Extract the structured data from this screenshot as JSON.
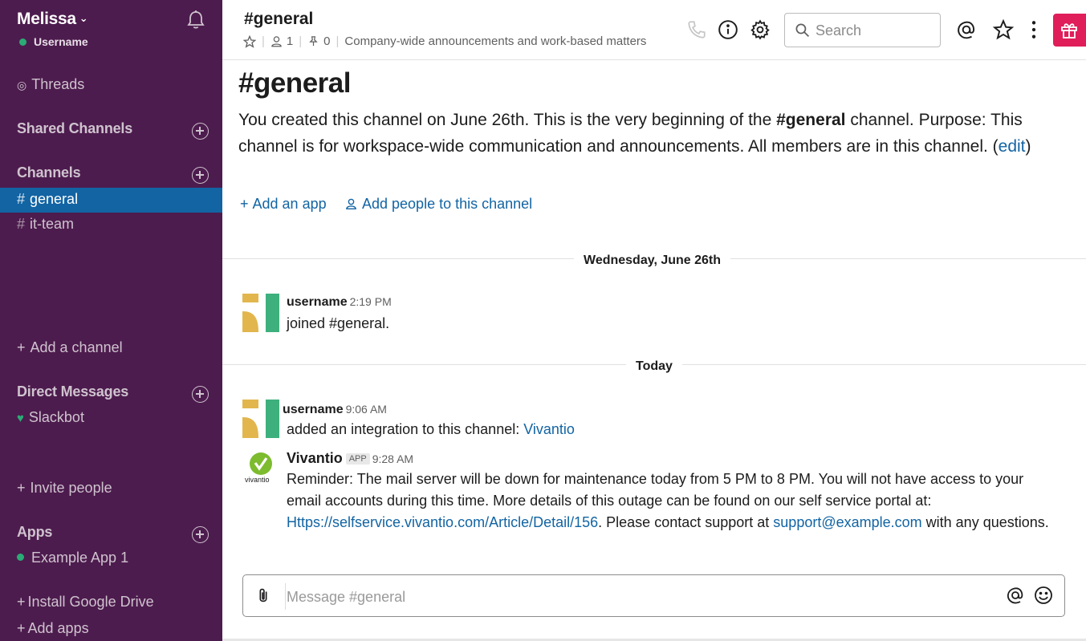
{
  "workspace": {
    "name": "Melissa",
    "user": "Username"
  },
  "sidebar": {
    "threads": "Threads",
    "shared_channels": "Shared Channels",
    "channels_heading": "Channels",
    "channels": [
      {
        "label": "general",
        "active": true
      },
      {
        "label": "it-team",
        "active": false
      }
    ],
    "add_channel": "Add a channel",
    "dm_heading": "Direct Messages",
    "dms": [
      {
        "label": "Slackbot"
      }
    ],
    "invite_people": "Invite people",
    "apps_heading": "Apps",
    "apps": [
      {
        "label": "Example App 1"
      }
    ],
    "install_google_drive": "Install Google Drive",
    "add_apps": "Add apps"
  },
  "header": {
    "title": "#general",
    "members_count": "1",
    "pins_count": "0",
    "topic": "Company-wide announcements and work-based matters",
    "search_placeholder": "Search"
  },
  "intro": {
    "title": "#general",
    "text_part1": "You created this channel on June 26th. This is the very beginning of the ",
    "channel_bold": "#general",
    "text_part2": " channel. Purpose: This channel is for workspace-wide communication and announcements. All members are in this channel. (",
    "edit_link": "edit",
    "text_part3": ")",
    "add_app": "Add an app",
    "add_people": "Add people to this channel"
  },
  "dividers": {
    "first": "Wednesday, June 26th",
    "second": "Today"
  },
  "messages": [
    {
      "author": "username",
      "time": "2:19 PM",
      "text": "joined #general."
    },
    {
      "author": "username",
      "time": "9:06 AM",
      "text": "added an integration to this channel: ",
      "link": "Vivantio"
    },
    {
      "author": "Vivantio",
      "badge": "APP",
      "time": "9:28 AM",
      "logo_text": "vivantio",
      "text_part1": "Reminder: The mail server will be down for maintenance today from 5 PM to 8 PM. You will not have access to your email accounts during this time. More details of this outage can be found on our self service portal at: ",
      "url": "Https://selfservice.vivantio.com/Article/Detail/156",
      "text_part2": ". Please contact support at ",
      "email": "support@example.com",
      "text_part3": " with any questions."
    }
  ],
  "composer": {
    "placeholder": "Message #general"
  },
  "colors": {
    "sidebar_bg": "#4d1c4e",
    "active_item": "#1264a3",
    "link": "#1264a3",
    "presence": "#2bac76",
    "gift": "#e01e5a"
  }
}
